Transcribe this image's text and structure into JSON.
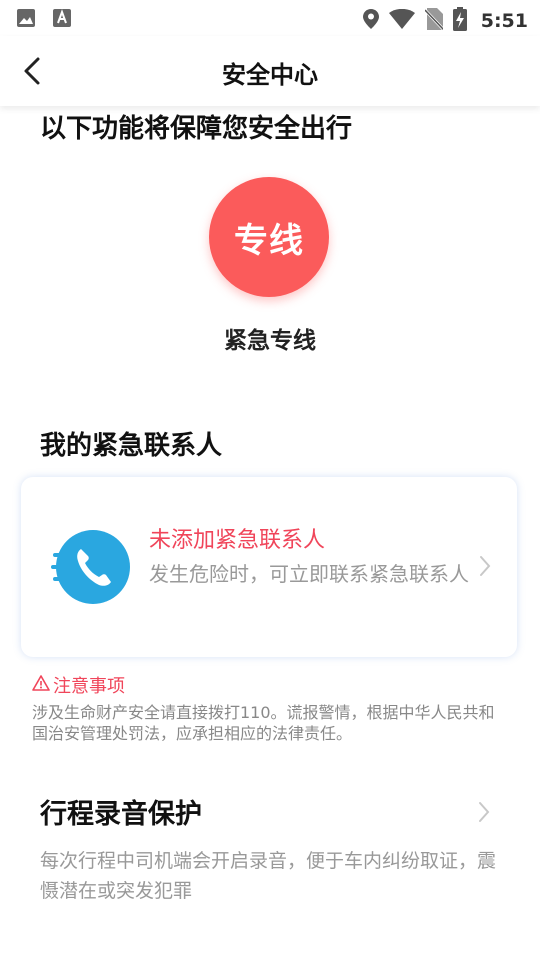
{
  "status_bar": {
    "time": "5:51",
    "left_icons": [
      "image-icon",
      "font-icon"
    ],
    "right_icons": [
      "location-icon",
      "wifi-icon",
      "no-sim-icon",
      "battery-charging-icon"
    ]
  },
  "header": {
    "title": "安全中心",
    "back_icon": "chevron-left-icon"
  },
  "intro": {
    "title": "以下功能将保障您安全出行"
  },
  "hotline": {
    "circle_text": "专线",
    "label": "紧急专线",
    "color": "#fb5b5b"
  },
  "contacts": {
    "section_title": "我的紧急联系人",
    "card_title": "未添加紧急联系人",
    "card_desc": "发生危险时，可立即联系紧急联系人",
    "icon": "phone-icon",
    "icon_color": "#2aa7e0"
  },
  "notice": {
    "title": "注意事项",
    "text": "涉及生命财产安全请直接拨打110。谎报警情，根据中华人民共和国治安管理处罚法，应承担相应的法律责任。",
    "color": "#f0455a"
  },
  "recording": {
    "title": "行程录音保护",
    "desc": "每次行程中司机端会开启录音，便于车内纠纷取证，震慑潜在或突发犯罪"
  }
}
